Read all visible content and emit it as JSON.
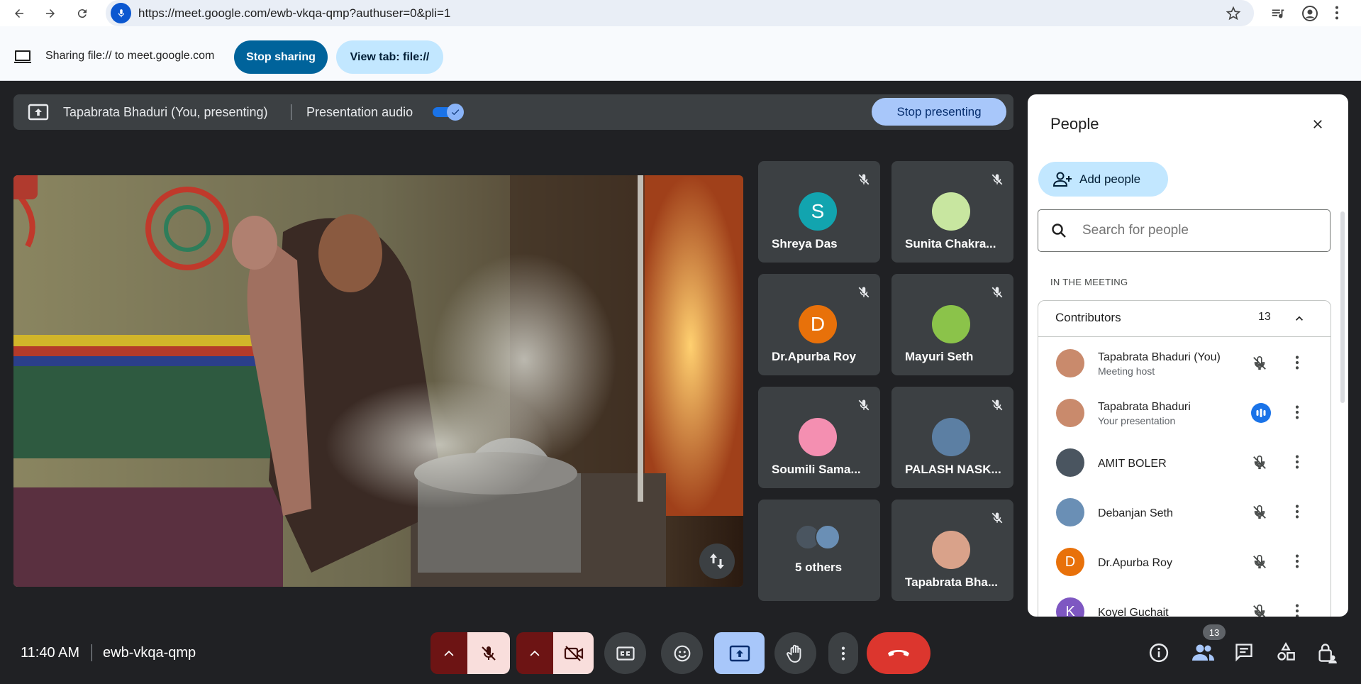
{
  "browser": {
    "url": "https://meet.google.com/ewb-vkqa-qmp?authuser=0&pli=1"
  },
  "share_bar": {
    "text": "Sharing file:// to meet.google.com",
    "stop_sharing": "Stop sharing",
    "view_tab": "View tab: file://"
  },
  "presenting_banner": {
    "presenter": "Tapabrata Bhaduri (You, presenting)",
    "audio_label": "Presentation audio",
    "audio_on": true,
    "stop_presenting": "Stop presenting"
  },
  "tiles": [
    {
      "name": "Shreya Das",
      "initial": "S",
      "color": "#12a4af"
    },
    {
      "name": "Sunita Chakra...",
      "initial": "",
      "color": "#c8e6a0"
    },
    {
      "name": "Dr.Apurba Roy",
      "initial": "D",
      "color": "#e8710a"
    },
    {
      "name": "Mayuri Seth",
      "initial": "",
      "color": "#8bc34a"
    },
    {
      "name": "Soumili Sama...",
      "initial": "",
      "color": "#f48fb1"
    },
    {
      "name": "PALASH NASK...",
      "initial": "",
      "color": "#5c7fa3"
    },
    {
      "name": "5 others",
      "initial": "",
      "color": "#6d7b86"
    },
    {
      "name": "Tapabrata Bha...",
      "initial": "",
      "color": "#d9a28a"
    }
  ],
  "people_panel": {
    "title": "People",
    "add_people": "Add people",
    "search_placeholder": "Search for people",
    "section_label": "IN THE MEETING",
    "group_label": "Contributors",
    "group_count": "13",
    "participants": [
      {
        "name": "Tapabrata Bhaduri (You)",
        "sub": "Meeting host",
        "initial": "",
        "color": "#c98a6c"
      },
      {
        "name": "Tapabrata Bhaduri",
        "sub": "Your presentation",
        "initial": "",
        "color": "#c98a6c"
      },
      {
        "name": "AMIT BOLER",
        "sub": "",
        "initial": "",
        "color": "#4a5560"
      },
      {
        "name": "Debanjan Seth",
        "sub": "",
        "initial": "",
        "color": "#6a8fb5"
      },
      {
        "name": "Dr.Apurba Roy",
        "sub": "",
        "initial": "D",
        "color": "#e8710a"
      },
      {
        "name": "Koyel Guchait",
        "sub": "",
        "initial": "K",
        "color": "#7e57c2"
      }
    ]
  },
  "bottom_bar": {
    "time": "11:40 AM",
    "meeting_code": "ewb-vkqa-qmp",
    "people_badge": "13"
  }
}
